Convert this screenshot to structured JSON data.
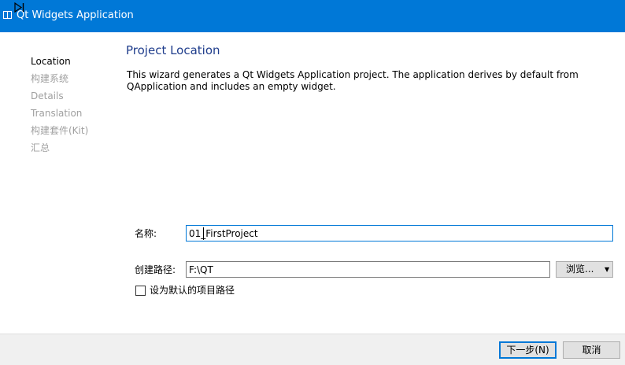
{
  "window": {
    "title": "Qt Widgets Application",
    "accent_color": "#0078d7",
    "icon": "window-icon"
  },
  "sidebar": {
    "active_marker_icon": "play-bar-icon",
    "steps": [
      {
        "label": "Location",
        "active": true
      },
      {
        "label": "构建系统",
        "active": false
      },
      {
        "label": "Details",
        "active": false
      },
      {
        "label": "Translation",
        "active": false
      },
      {
        "label": "构建套件(Kit)",
        "active": false
      },
      {
        "label": "汇总",
        "active": false
      }
    ]
  },
  "main": {
    "title": "Project Location",
    "description": "This wizard generates a Qt Widgets Application project. The application derives by default from QApplication and includes an empty widget.",
    "name_label": "名称:",
    "name_value": "01_FirstProject",
    "path_label": "创建路径:",
    "path_value": "F:\\QT",
    "browse_label": "浏览...",
    "browse_arrow_icon": "dropdown-arrow-icon",
    "default_path_label": "设为默认的项目路径",
    "default_path_checked": false
  },
  "footer": {
    "next_label": "下一步(N)",
    "cancel_label": "取消"
  }
}
